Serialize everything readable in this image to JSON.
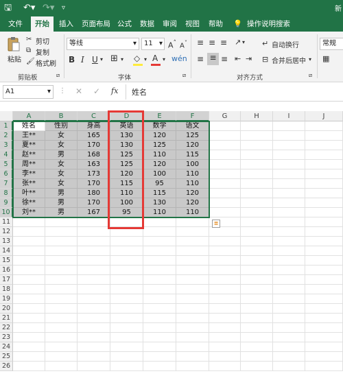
{
  "titlebar": {
    "right_text": "新"
  },
  "tabs": [
    "文件",
    "开始",
    "插入",
    "页面布局",
    "公式",
    "数据",
    "审阅",
    "视图",
    "帮助"
  ],
  "tell_me": "操作说明搜索",
  "ribbon": {
    "paste": "粘贴",
    "cut": "剪切",
    "copy": "复制",
    "format_painter": "格式刷",
    "clipboard_label": "剪贴板",
    "font_name": "等线",
    "font_size": "11",
    "font_label": "字体",
    "wrap_text": "自动换行",
    "merge_center": "合并后居中",
    "align_label": "对齐方式",
    "number_format": "常规",
    "font_color": "#e53935",
    "fill_color": "#ffeb3b"
  },
  "formula_bar": {
    "name_box": "A1",
    "fx": "fx",
    "content": "姓名"
  },
  "columns": [
    "A",
    "B",
    "C",
    "D",
    "E",
    "F",
    "G",
    "H",
    "I",
    "J"
  ],
  "rows": [
    "1",
    "2",
    "3",
    "4",
    "5",
    "6",
    "7",
    "8",
    "9",
    "10",
    "11",
    "12",
    "13",
    "14",
    "15",
    "16",
    "17",
    "18",
    "19",
    "20",
    "21",
    "22",
    "23",
    "24",
    "25",
    "26"
  ],
  "table": [
    [
      "姓名",
      "性别",
      "身高",
      "英语",
      "数学",
      "语文"
    ],
    [
      "王**",
      "女",
      "165",
      "130",
      "120",
      "125"
    ],
    [
      "夏**",
      "女",
      "170",
      "130",
      "125",
      "120"
    ],
    [
      "赵**",
      "男",
      "168",
      "125",
      "110",
      "115"
    ],
    [
      "周**",
      "女",
      "163",
      "125",
      "120",
      "100"
    ],
    [
      "李**",
      "女",
      "173",
      "120",
      "100",
      "110"
    ],
    [
      "张**",
      "女",
      "170",
      "115",
      "95",
      "110"
    ],
    [
      "叶**",
      "男",
      "180",
      "110",
      "115",
      "120"
    ],
    [
      "徐**",
      "男",
      "170",
      "100",
      "130",
      "120"
    ],
    [
      "刘**",
      "男",
      "167",
      "95",
      "110",
      "110"
    ]
  ],
  "accent": "#217346",
  "highlight_color": "#e53935"
}
